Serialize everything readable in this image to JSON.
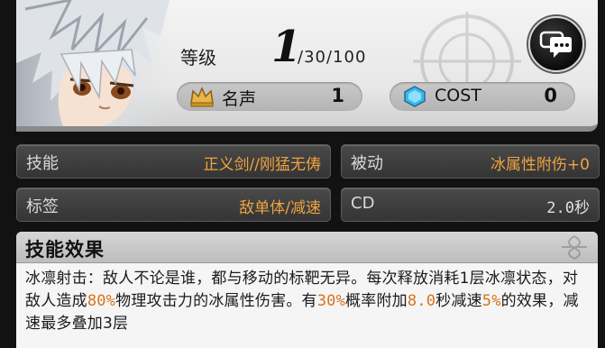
{
  "colors": {
    "accent_orange": "#f0a340",
    "highlight_orange": "#d9731a",
    "panel_dark": "#3a3a3a"
  },
  "profile": {
    "level_label": "等级",
    "level_current": "1",
    "level_max": "/30/100",
    "fame": {
      "icon": "crown-icon",
      "label": "名声",
      "value": "1"
    },
    "cost": {
      "icon": "blue-gem-icon",
      "label": "COST",
      "value": "0"
    }
  },
  "chat_button": {
    "icon": "chat-bubble-icon"
  },
  "info": {
    "skill": {
      "label": "技能",
      "value": "正义剑//刚猛无俦"
    },
    "passive": {
      "label": "被动",
      "value": "冰属性附伤+0"
    },
    "tag": {
      "label": "标签",
      "value": "敌单体/减速"
    },
    "cd": {
      "label": "CD",
      "value": "2.0秒"
    }
  },
  "effect": {
    "title": "技能效果",
    "segments": [
      {
        "text": "冰凛射击：敌人不论是谁，都与移动的标靶无异。每次释放消耗1层冰凛状态，对敌人造成"
      },
      {
        "text": "80%",
        "highlight": true
      },
      {
        "text": "物理攻击力的冰属性伤害。有"
      },
      {
        "text": "30%",
        "highlight": true
      },
      {
        "text": "概率附加"
      },
      {
        "text": "8.0",
        "highlight": true
      },
      {
        "text": "秒减速"
      },
      {
        "text": "5%",
        "highlight": true
      },
      {
        "text": "的效果，减速最多叠加3层"
      }
    ]
  }
}
